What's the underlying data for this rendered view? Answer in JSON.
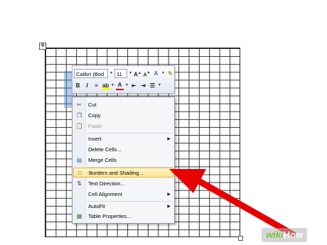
{
  "toolbar": {
    "font_name": "Calibri (Bod",
    "font_size": "11",
    "row1_icons": [
      "grow-font-icon",
      "shrink-font-icon",
      "styles-icon",
      "format-painter-icon"
    ],
    "row2_icons": [
      "bold-icon",
      "italic-icon",
      "center-align-icon",
      "highlight-icon",
      "font-color-icon",
      "decrease-indent-icon",
      "increase-indent-icon",
      "bullets-icon"
    ],
    "bold_label": "B",
    "italic_label": "I"
  },
  "menu": {
    "items": [
      {
        "label": "Cut",
        "icon": "scissors-icon",
        "enabled": true
      },
      {
        "label": "Copy",
        "icon": "copy-icon",
        "enabled": true
      },
      {
        "label": "Paste",
        "icon": "paste-icon",
        "enabled": false
      },
      {
        "label": "Insert",
        "icon": "",
        "enabled": true,
        "submenu": true
      },
      {
        "label": "Delete Cells...",
        "icon": "",
        "enabled": true
      },
      {
        "label": "Merge Cells",
        "icon": "merge-cells-icon",
        "enabled": true
      },
      {
        "label": "Borders and Shading...",
        "icon": "borders-icon",
        "enabled": true,
        "highlighted": true
      },
      {
        "label": "Text Direction...",
        "icon": "text-direction-icon",
        "enabled": true
      },
      {
        "label": "Cell Alignment",
        "icon": "",
        "enabled": true,
        "submenu": true
      },
      {
        "label": "AutoFit",
        "icon": "",
        "enabled": true,
        "submenu": true
      },
      {
        "label": "Table Properties...",
        "icon": "table-properties-icon",
        "enabled": true
      }
    ]
  },
  "watermark": {
    "wiki": "wiki",
    "how": "How"
  },
  "colors": {
    "highlight_bg": "#ffe48a",
    "arrow": "#e60000",
    "selection": "#508cd2"
  }
}
